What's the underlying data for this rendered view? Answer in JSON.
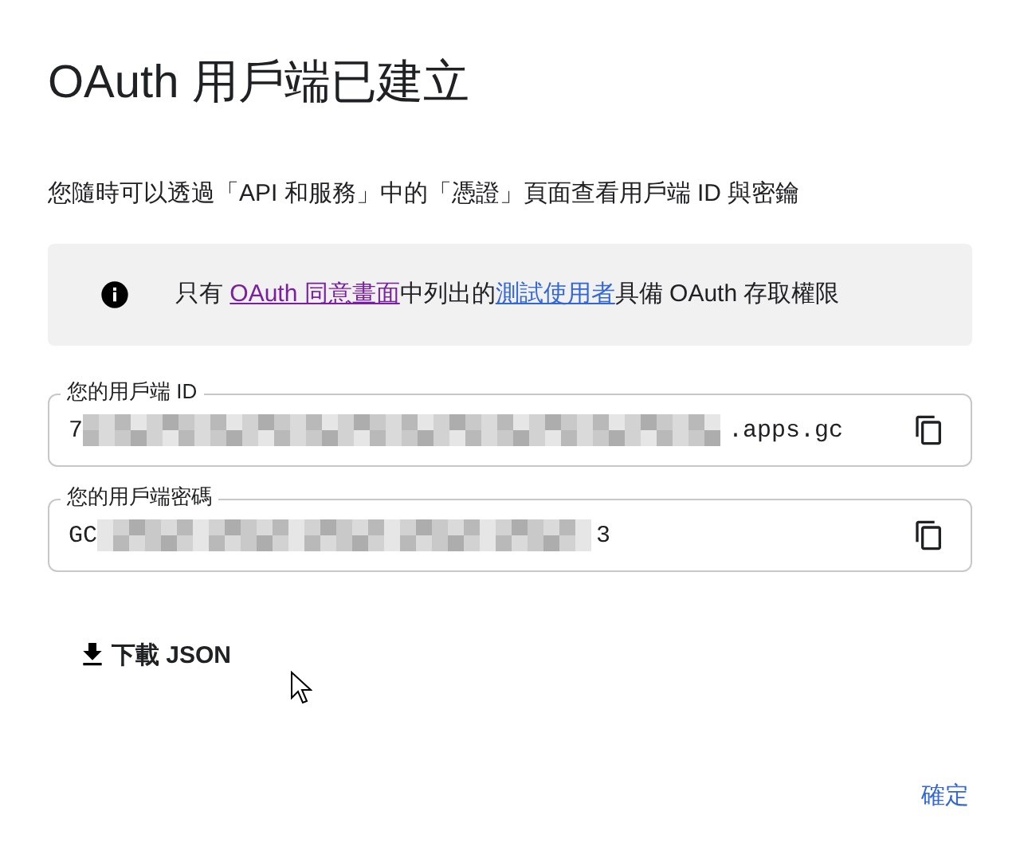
{
  "dialog": {
    "title": "OAuth 用戶端已建立",
    "description": "您隨時可以透過「API 和服務」中的「憑證」頁面查看用戶端 ID 與密鑰",
    "notice": {
      "parts": [
        {
          "kind": "text",
          "text": "只有 "
        },
        {
          "kind": "link",
          "text": "OAuth 同意畫面",
          "visited": true
        },
        {
          "kind": "text",
          "text": "中列出的"
        },
        {
          "kind": "link",
          "text": "測試使用者",
          "visited": false
        },
        {
          "kind": "text",
          "text": "具備 OAuth 存取權限"
        }
      ]
    },
    "fields": [
      {
        "label": "您的用戶端 ID",
        "prefix": "7",
        "suffix": ".apps.gc"
      },
      {
        "label": "您的用戶端密碼",
        "prefix": "GC",
        "suffix": "3"
      }
    ],
    "download_button": "下載 JSON",
    "ok_button": "確定"
  }
}
